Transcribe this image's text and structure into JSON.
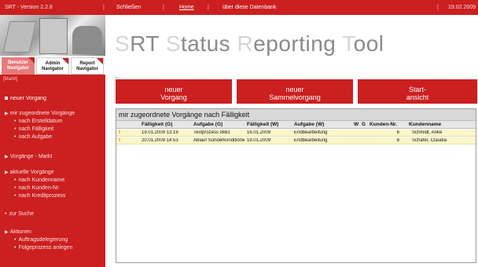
{
  "topbar": {
    "version": "SRT - Version 2.2.8",
    "close": "Schließen",
    "home": "Home",
    "about": "über diese Datenbank",
    "date": "19.02.2009"
  },
  "sidebar": {
    "tabs": {
      "benutzer": "Benutzer Navigator",
      "admin": "Admin Navigator",
      "report": "Report Navigator"
    },
    "mark": "[Markt]",
    "items": {
      "neuer_vorgang": "neuer Vorgang",
      "zugeordnet": "mir zugeordnete Vorgänge",
      "nach_erstelldatum": "nach Erstelldatum",
      "nach_faelligkeit": "nach Fälligkeit",
      "nach_aufgabe": "nach Aufgabe",
      "vorgaenge_markt": "Vorgänge - Markt",
      "aktuelle": "aktuelle Vorgänge",
      "nach_kundenname": "nach Kundenname",
      "nach_kundennr": "nach Kunden-Nr.",
      "nach_kreditprozess": "nach Kreditprozess",
      "zur_suche": "zur Suche",
      "aktionen": "Aktionen",
      "auftragsdelegierung": "Auftragsdelegierung",
      "folgeprozess": "Folgeprozess anlegen"
    }
  },
  "brand": {
    "s1": "S",
    "r1": "RT ",
    "s2": "S",
    "r2": "tatus ",
    "s3": "R",
    "r3": "eporting ",
    "s4": "T",
    "r4": "ool"
  },
  "dash": "_",
  "buttons": {
    "neuer_l1": "neuer",
    "neuer_l2": "Vorgang",
    "sammel_l1": "neuer",
    "sammel_l2": "Sammelvorgang",
    "start_l1": "Start-",
    "start_l2": "ansicht"
  },
  "panel": {
    "title": "mir zugeordnete Vorgänge nach Fälligkeit",
    "headers": {
      "faelligkeit_g": "Fälligkeit (G)",
      "aufgabe_g": "Aufgabe (G)",
      "faelligkeit_w": "Fälligkeit (W)",
      "aufgabe_w": "Aufgabe (W)",
      "w": "W",
      "g": "G",
      "kundennr": "Kunden-Nr.",
      "kundenname": "Kundenname"
    },
    "rows": [
      {
        "flag": "! ",
        "faelligkeit_g": "19.01.2009 13:19",
        "aufgabe_g": "Testprozess IBB1",
        "faelligkeit_w": "16.01.2009",
        "aufgabe_w": "Endbearbeitung",
        "w_color": "#d42020",
        "g_color": "#2fa82f",
        "kundennr": "6",
        "kundenname": "Schmidt, Anke"
      },
      {
        "flag": "! ",
        "faelligkeit_g": "20.01.2009 14:53",
        "aufgabe_g": "Ablauf Sonderkonditione",
        "faelligkeit_w": "19.01.2009",
        "aufgabe_w": "Endbearbeitung",
        "w_color": "#2fa82f",
        "g_color": "#2fa82f",
        "kundennr": "8",
        "kundenname": "Schäfer, Claudia"
      }
    ]
  }
}
